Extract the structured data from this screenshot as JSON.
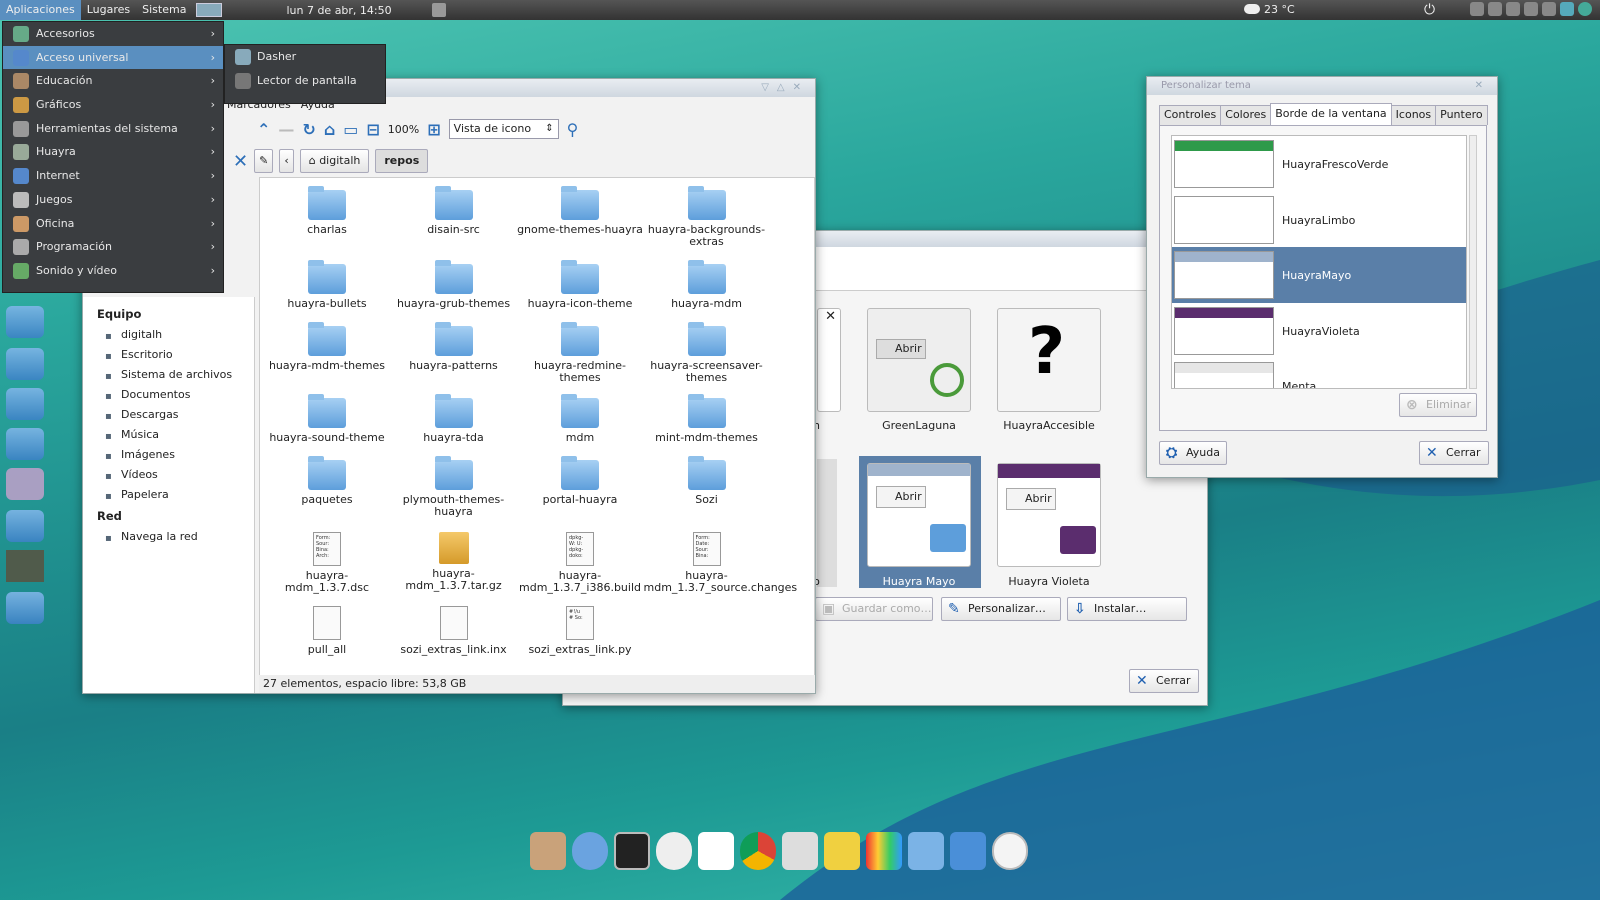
{
  "panel": {
    "menus": [
      "Aplicaciones",
      "Lugares",
      "Sistema"
    ],
    "clock": "lun  7 de abr, 14:50",
    "weather": "23 °C"
  },
  "apps_menu": [
    {
      "label": "Accesorios",
      "icon": "accessories-icon",
      "color": "#6a8"
    },
    {
      "label": "Acceso universal",
      "icon": "accessibility-icon",
      "color": "#58c"
    },
    {
      "label": "Educación",
      "icon": "education-icon",
      "color": "#a86"
    },
    {
      "label": "Gráficos",
      "icon": "graphics-icon",
      "color": "#c94"
    },
    {
      "label": "Herramientas del sistema",
      "icon": "system-tools-icon",
      "color": "#999"
    },
    {
      "label": "Huayra",
      "icon": "huayra-icon",
      "color": "#9a9"
    },
    {
      "label": "Internet",
      "icon": "internet-icon",
      "color": "#58c"
    },
    {
      "label": "Juegos",
      "icon": "games-icon",
      "color": "#bbb"
    },
    {
      "label": "Oficina",
      "icon": "office-icon",
      "color": "#c96"
    },
    {
      "label": "Programación",
      "icon": "programming-icon",
      "color": "#aaa"
    },
    {
      "label": "Sonido y vídeo",
      "icon": "sound-video-icon",
      "color": "#6a6"
    }
  ],
  "submenu": [
    "Dasher",
    "Lector de pantalla"
  ],
  "fm": {
    "menubar": [
      "Marcadores",
      "Ayuda"
    ],
    "zoom": "100%",
    "view": "Vista de icono",
    "path": [
      "digitalh",
      "repos"
    ],
    "sidebar": {
      "equipo": "Equipo",
      "equipo_items": [
        "digitalh",
        "Escritorio",
        "Sistema de archivos",
        "Documentos",
        "Descargas",
        "Música",
        "Imágenes",
        "Vídeos",
        "Papelera"
      ],
      "red": "Red",
      "red_items": [
        "Navega la red"
      ]
    },
    "files": [
      {
        "n": "charlas",
        "t": "f"
      },
      {
        "n": "disain-src",
        "t": "f"
      },
      {
        "n": "gnome-themes-huayra",
        "t": "f"
      },
      {
        "n": "huayra-backgrounds-extras",
        "t": "f"
      },
      {
        "n": "huayra-bullets",
        "t": "f"
      },
      {
        "n": "huayra-grub-themes",
        "t": "f"
      },
      {
        "n": "huayra-icon-theme",
        "t": "f"
      },
      {
        "n": "huayra-mdm",
        "t": "f"
      },
      {
        "n": "huayra-mdm-themes",
        "t": "f"
      },
      {
        "n": "huayra-patterns",
        "t": "f"
      },
      {
        "n": "huayra-redmine-themes",
        "t": "f"
      },
      {
        "n": "huayra-screensaver-themes",
        "t": "f"
      },
      {
        "n": "huayra-sound-theme",
        "t": "f"
      },
      {
        "n": "huayra-tda",
        "t": "f"
      },
      {
        "n": "mdm",
        "t": "f"
      },
      {
        "n": "mint-mdm-themes",
        "t": "f"
      },
      {
        "n": "paquetes",
        "t": "f"
      },
      {
        "n": "plymouth-themes-huayra",
        "t": "f"
      },
      {
        "n": "portal-huayra",
        "t": "f"
      },
      {
        "n": "Sozi",
        "t": "f"
      },
      {
        "n": "huayra-mdm_1.3.7.dsc",
        "t": "d",
        "c": "Form:\nSour:\nBina:\nArch:"
      },
      {
        "n": "huayra-mdm_1.3.7.tar.gz",
        "t": "p"
      },
      {
        "n": "huayra-mdm_1.3.7_i386.build",
        "t": "d",
        "c": "dpkg-\nW: U:\ndpkg-\ndoko:"
      },
      {
        "n": "huayra-mdm_1.3.7_source.changes",
        "t": "d",
        "c": "Form:\nDate:\nSour:\nBina:"
      },
      {
        "n": "pull_all",
        "t": "d",
        "c": ""
      },
      {
        "n": "sozi_extras_link.inx",
        "t": "d",
        "c": ""
      },
      {
        "n": "sozi_extras_link.py",
        "t": "d",
        "c": "#!/u\n# So:"
      }
    ],
    "status": "27 elementos, espacio libre: 53,8 GB"
  },
  "appearance": {
    "themes_row1": [
      "gh",
      "GreenLaguna",
      "HuayraAccesible"
    ],
    "themes_row2": [
      "bo",
      "Huayra Mayo",
      "Huayra Violeta"
    ],
    "open_label": "Abrir",
    "save_as": "Guardar como…",
    "customize": "Personalizar…",
    "install": "Instalar…",
    "close": "Cerrar"
  },
  "customize": {
    "title": "Personalizar tema",
    "tabs": [
      "Controles",
      "Colores",
      "Borde de la ventana",
      "Iconos",
      "Puntero"
    ],
    "themes": [
      {
        "n": "HuayraFrescoVerde",
        "c": "#2e9a4a"
      },
      {
        "n": "HuayraLimbo",
        "c": "#ffffff"
      },
      {
        "n": "HuayraMayo",
        "c": "#9fb3cc"
      },
      {
        "n": "HuayraVioleta",
        "c": "#5b2d6e"
      },
      {
        "n": "Menta",
        "c": "#e6e6e6"
      }
    ],
    "remove": "Eliminar",
    "help": "Ayuda",
    "close": "Cerrar"
  },
  "colors": {
    "accent": "#5a8fc0",
    "selection": "#5a7fa8"
  }
}
